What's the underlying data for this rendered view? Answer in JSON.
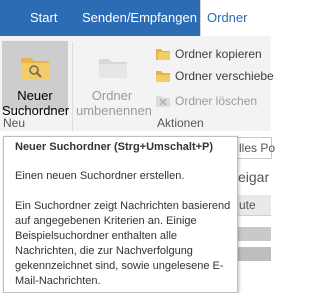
{
  "tabs": [
    "Start",
    "Senden/Empfangen",
    "Ordner"
  ],
  "ribbon": {
    "new_search_folder": [
      "Neuer",
      "Suchordner"
    ],
    "rename_folder": [
      "Ordner",
      "umbenennen"
    ],
    "copy_folder": "Ordner kopieren",
    "move_folder": "Ordner verschiebe",
    "delete_folder": "Ordner löschen",
    "group_new": "Neu",
    "group_actions": "Aktionen"
  },
  "background": {
    "all_folders": "lles Po",
    "sort_field": "eigar",
    "column": "ute"
  },
  "tooltip": {
    "title": "Neuer Suchordner (Strg+Umschalt+P)",
    "line1": "Einen neuen Suchordner erstellen.",
    "body": "Ein Suchordner zeigt Nachrichten basierend auf angegebenen Kriterien an. Einige Beispielsuchordner enthalten alle Nachrichten, die zur Nachverfolgung gekennzeichnet sind, sowie ungelesene E-Mail-Nachrichten."
  },
  "colors": {
    "tabbar": "#2b6cb5",
    "ribbon": "#f3f3f3",
    "hover": "#cdcdcd",
    "folder": "#e8b34a"
  }
}
